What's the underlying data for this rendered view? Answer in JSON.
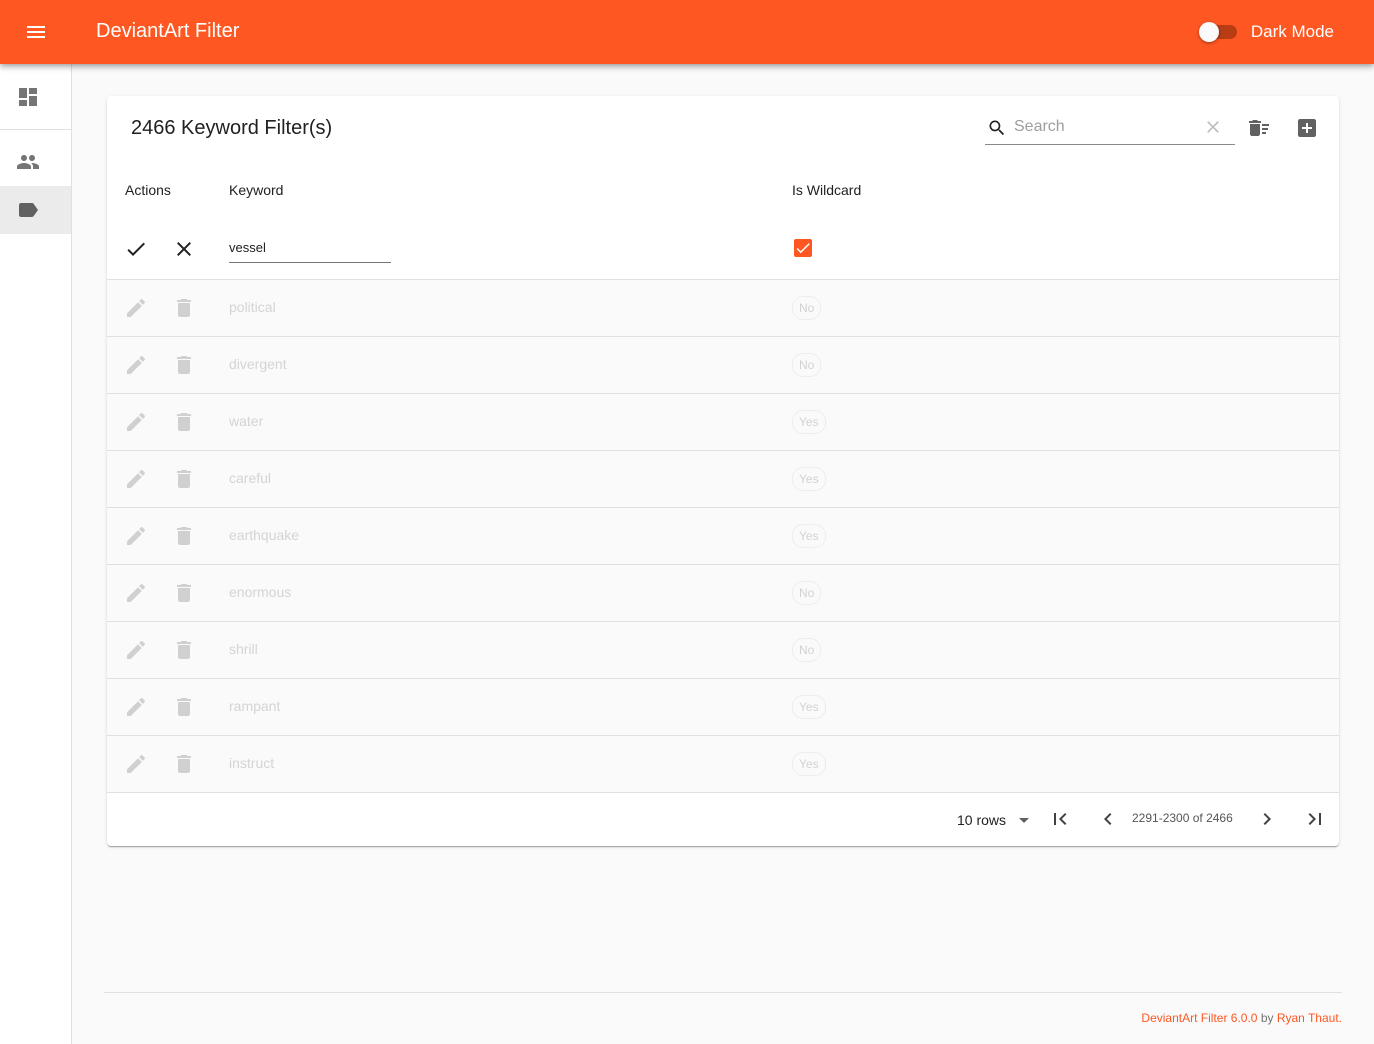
{
  "app": {
    "title": "DeviantArt Filter",
    "dark_mode_label": "Dark Mode",
    "dark_mode_on": false,
    "accent_color": "#ff5722"
  },
  "nav": {
    "items": [
      {
        "name": "dashboard",
        "icon": "dashboard-icon",
        "active": false
      },
      {
        "name": "users",
        "icon": "people-icon",
        "active": false
      },
      {
        "name": "keywords",
        "icon": "label-icon",
        "active": true
      }
    ]
  },
  "table": {
    "title": "2466 Keyword Filter(s)",
    "search_placeholder": "Search",
    "columns": [
      "Actions",
      "Keyword",
      "Is Wildcard"
    ],
    "editing_row": {
      "keyword": "vessel",
      "is_wildcard": true
    },
    "rows": [
      {
        "keyword": "political",
        "wildcard": "No"
      },
      {
        "keyword": "divergent",
        "wildcard": "No"
      },
      {
        "keyword": "water",
        "wildcard": "Yes"
      },
      {
        "keyword": "careful",
        "wildcard": "Yes"
      },
      {
        "keyword": "earthquake",
        "wildcard": "Yes"
      },
      {
        "keyword": "enormous",
        "wildcard": "No"
      },
      {
        "keyword": "shrill",
        "wildcard": "No"
      },
      {
        "keyword": "rampant",
        "wildcard": "Yes"
      },
      {
        "keyword": "instruct",
        "wildcard": "Yes"
      }
    ]
  },
  "pagination": {
    "rows_label": "10 rows",
    "range": "2291-2300 of 2466"
  },
  "footer": {
    "product": "DeviantArt Filter 6.0.0",
    "by": "by",
    "author": "Ryan Thaut."
  }
}
